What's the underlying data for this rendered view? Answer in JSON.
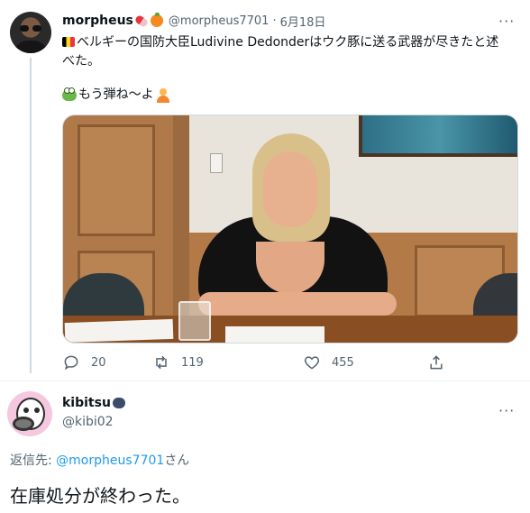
{
  "tweet": {
    "display_name": "morpheus",
    "handle": "@morpheus7701",
    "separator": "·",
    "date": "6月18日",
    "text_line1": "ベルギーの国防大臣Ludivine Dedonderはウク豚に送る武器が尽きたと述",
    "text_line2": "べた。",
    "text_extra": "もう弾ね～よ",
    "stats": {
      "replies": "20",
      "retweets": "119",
      "likes": "455"
    }
  },
  "reply": {
    "display_name": "kibitsu",
    "handle": "@kibi02",
    "reply_to_label": "返信先: ",
    "reply_to_handle": "@morpheus7701",
    "reply_to_suffix": "さん",
    "text": "在庫処分が終わった。"
  },
  "icons": {
    "more": "more-dots-icon",
    "reply": "reply-bubble-icon",
    "retweet": "retweet-icon",
    "like": "heart-icon",
    "share": "share-icon"
  },
  "colors": {
    "text": "#0f1419",
    "secondary": "#536471",
    "link": "#1d9bf0",
    "thread_line": "#cfd9de"
  }
}
